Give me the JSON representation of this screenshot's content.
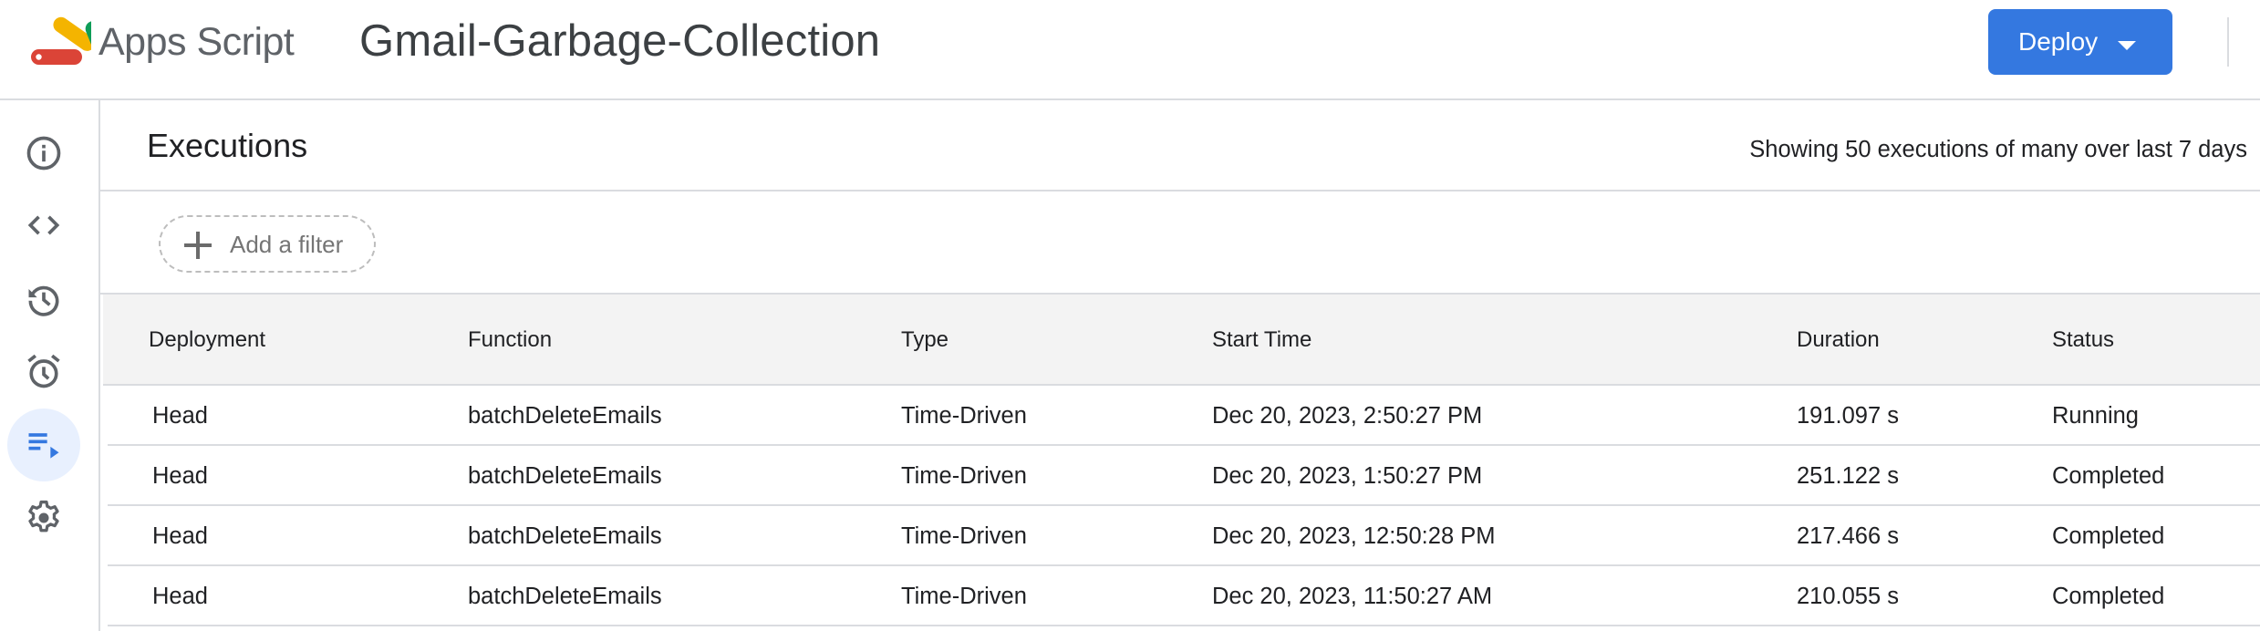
{
  "header": {
    "app_name": "Apps Script",
    "project_title": "Gmail-Garbage-Collection",
    "deploy_label": "Deploy",
    "logo_colors": [
      "#db4437",
      "#f4b400",
      "#0f9d58",
      "#4285f4"
    ],
    "accent_color": "#3478e0"
  },
  "sidebar": {
    "items": [
      {
        "name": "overview",
        "icon": "info-icon",
        "active": false
      },
      {
        "name": "editor",
        "icon": "code-icon",
        "active": false
      },
      {
        "name": "project-history",
        "icon": "history-icon",
        "active": false
      },
      {
        "name": "triggers",
        "icon": "alarm-clock-icon",
        "active": false
      },
      {
        "name": "executions",
        "icon": "executions-icon",
        "active": true
      },
      {
        "name": "project-settings",
        "icon": "gear-icon",
        "active": false
      }
    ]
  },
  "main": {
    "title": "Executions",
    "summary": "Showing 50 executions of many over last 7 days",
    "filter_label": "Add a filter"
  },
  "table": {
    "columns": [
      "Deployment",
      "Function",
      "Type",
      "Start Time",
      "Duration",
      "Status"
    ],
    "rows": [
      {
        "deployment": "Head",
        "function": "batchDeleteEmails",
        "type": "Time-Driven",
        "start_time": "Dec 20, 2023, 2:50:27 PM",
        "duration": "191.097 s",
        "status": "Running"
      },
      {
        "deployment": "Head",
        "function": "batchDeleteEmails",
        "type": "Time-Driven",
        "start_time": "Dec 20, 2023, 1:50:27 PM",
        "duration": "251.122 s",
        "status": "Completed"
      },
      {
        "deployment": "Head",
        "function": "batchDeleteEmails",
        "type": "Time-Driven",
        "start_time": "Dec 20, 2023, 12:50:28 PM",
        "duration": "217.466 s",
        "status": "Completed"
      },
      {
        "deployment": "Head",
        "function": "batchDeleteEmails",
        "type": "Time-Driven",
        "start_time": "Dec 20, 2023, 11:50:27 AM",
        "duration": "210.055 s",
        "status": "Completed"
      }
    ]
  }
}
